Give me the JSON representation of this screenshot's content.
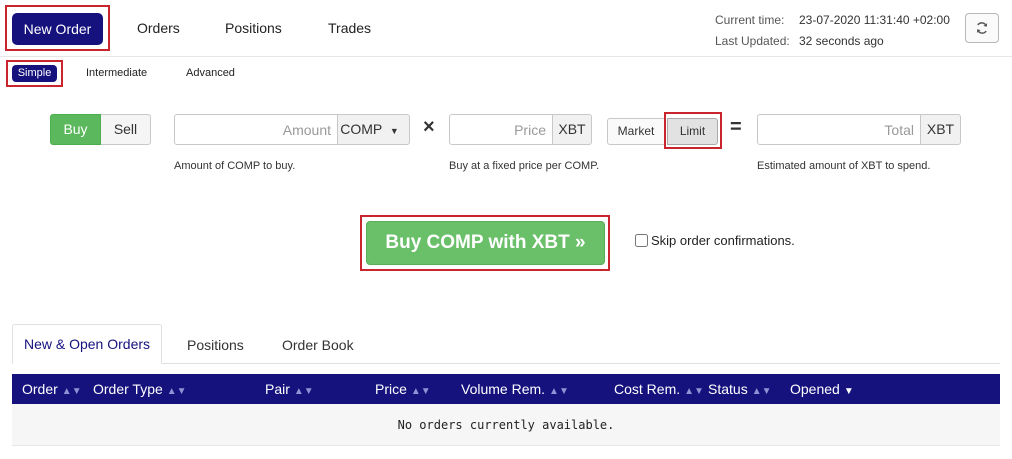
{
  "nav": {
    "new_order": "New Order",
    "orders": "Orders",
    "positions": "Positions",
    "trades": "Trades"
  },
  "status": {
    "current_time_label": "Current time:",
    "current_time": "23-07-2020 11:31:40 +02:00",
    "last_updated_label": "Last Updated:",
    "last_updated": "32 seconds ago"
  },
  "subtabs": {
    "simple": "Simple",
    "intermediate": "Intermediate",
    "advanced": "Advanced"
  },
  "form": {
    "buy": "Buy",
    "sell": "Sell",
    "amount_placeholder": "Amount",
    "amount_currency": "COMP",
    "amount_hint": "Amount of COMP to buy.",
    "times": "×",
    "price_placeholder": "Price",
    "price_currency": "XBT",
    "price_hint": "Buy at a fixed price per COMP.",
    "market": "Market",
    "limit": "Limit",
    "equals": "=",
    "total_placeholder": "Total",
    "total_currency": "XBT",
    "total_hint": "Estimated amount of XBT to spend.",
    "submit": "Buy COMP with XBT »",
    "skip_confirm": "Skip order confirmations."
  },
  "bottom_tabs": {
    "open_orders": "New & Open Orders",
    "positions": "Positions",
    "order_book": "Order Book"
  },
  "table": {
    "headers": [
      "Order",
      "Order Type",
      "Pair",
      "Price",
      "Volume Rem.",
      "Cost Rem.",
      "Status",
      "Opened"
    ],
    "empty": "No orders currently available."
  },
  "colors": {
    "brand_navy": "#15127d",
    "buy_green": "#5cb85c",
    "highlight_red": "#c9252c"
  }
}
